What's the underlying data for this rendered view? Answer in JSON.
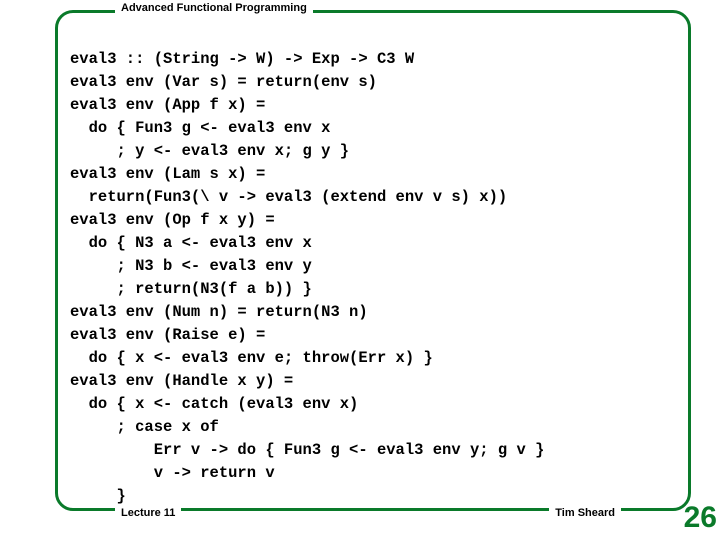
{
  "header": {
    "title": "Advanced Functional Programming"
  },
  "code": {
    "text": "eval3 :: (String -> W) -> Exp -> C3 W\neval3 env (Var s) = return(env s)\neval3 env (App f x) =\n  do { Fun3 g <- eval3 env x\n     ; y <- eval3 env x; g y }\neval3 env (Lam s x) =\n  return(Fun3(\\ v -> eval3 (extend env v s) x))\neval3 env (Op f x y) =\n  do { N3 a <- eval3 env x\n     ; N3 b <- eval3 env y\n     ; return(N3(f a b)) }\neval3 env (Num n) = return(N3 n)\neval3 env (Raise e) =\n  do { x <- eval3 env e; throw(Err x) }\neval3 env (Handle x y) =\n  do { x <- catch (eval3 env x)\n     ; case x of\n         Err v -> do { Fun3 g <- eval3 env y; g v }\n         v -> return v\n     }"
  },
  "footer": {
    "lecture": "Lecture 11",
    "author": "Tim Sheard",
    "page": "26"
  }
}
